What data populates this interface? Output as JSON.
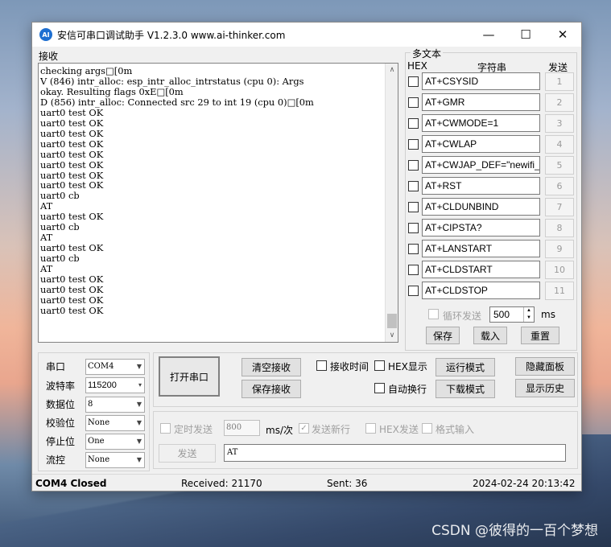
{
  "window": {
    "title": "安信可串口调试助手 V1.2.3.0    www.ai-thinker.com",
    "icon": "AI"
  },
  "receive": {
    "label": "接收",
    "content": "checking args□[0m\nV (846) intr_alloc: esp_intr_alloc_intrstatus (cpu 0): Args\nokay. Resulting flags 0xE□[0m\nD (856) intr_alloc: Connected src 29 to int 19 (cpu 0)□[0m\nuart0 test OK\nuart0 test OK\nuart0 test OK\nuart0 test OK\nuart0 test OK\nuart0 test OK\nuart0 test OK\nuart0 test OK\nuart0 cb\nAT\nuart0 test OK\nuart0 cb\nAT\nuart0 test OK\nuart0 cb\nAT\nuart0 test OK\nuart0 test OK\nuart0 test OK\nuart0 test OK"
  },
  "multi": {
    "title": "多文本",
    "hex_header": "HEX",
    "str_header": "字符串",
    "send_header": "发送",
    "commands": [
      {
        "text": "AT+CSYSID",
        "num": "1"
      },
      {
        "text": "AT+GMR",
        "num": "2"
      },
      {
        "text": "AT+CWMODE=1",
        "num": "3"
      },
      {
        "text": "AT+CWLAP",
        "num": "4"
      },
      {
        "text": "AT+CWJAP_DEF=\"newifi_",
        "num": "5"
      },
      {
        "text": "AT+RST",
        "num": "6"
      },
      {
        "text": "AT+CLDUNBIND",
        "num": "7"
      },
      {
        "text": "AT+CIPSTA?",
        "num": "8"
      },
      {
        "text": "AT+LANSTART",
        "num": "9"
      },
      {
        "text": "AT+CLDSTART",
        "num": "10"
      },
      {
        "text": "AT+CLDSTOP",
        "num": "11"
      }
    ],
    "loop_label": "循环发送",
    "loop_value": "500",
    "loop_unit": "ms",
    "save": "保存",
    "load": "载入",
    "reset": "重置"
  },
  "serial": {
    "port_label": "串口",
    "port_value": "COM4",
    "baud_label": "波特率",
    "baud_value": "115200",
    "data_label": "数据位",
    "data_value": "8",
    "parity_label": "校验位",
    "parity_value": "None",
    "stop_label": "停止位",
    "stop_value": "One",
    "flow_label": "流控",
    "flow_value": "None"
  },
  "controls": {
    "open_port": "打开串口",
    "clear_recv": "清空接收",
    "save_recv": "保存接收",
    "recv_time": "接收时间",
    "hex_display": "HEX显示",
    "auto_wrap": "自动换行",
    "run_mode": "运行模式",
    "download_mode": "下载模式",
    "hide_panel": "隐藏面板",
    "show_history": "显示历史"
  },
  "send": {
    "timed_label": "定时发送",
    "period_value": "800",
    "period_unit": "ms/次",
    "newline_label": "发送新行",
    "hex_label": "HEX发送",
    "format_label": "格式输入",
    "send_button": "发送",
    "input_value": "AT"
  },
  "status": {
    "port": "COM4 Closed",
    "received": "Received: 21170",
    "sent": "Sent: 36",
    "time": "2024-02-24 20:13:42"
  },
  "watermark": "CSDN @彼得的一百个梦想"
}
